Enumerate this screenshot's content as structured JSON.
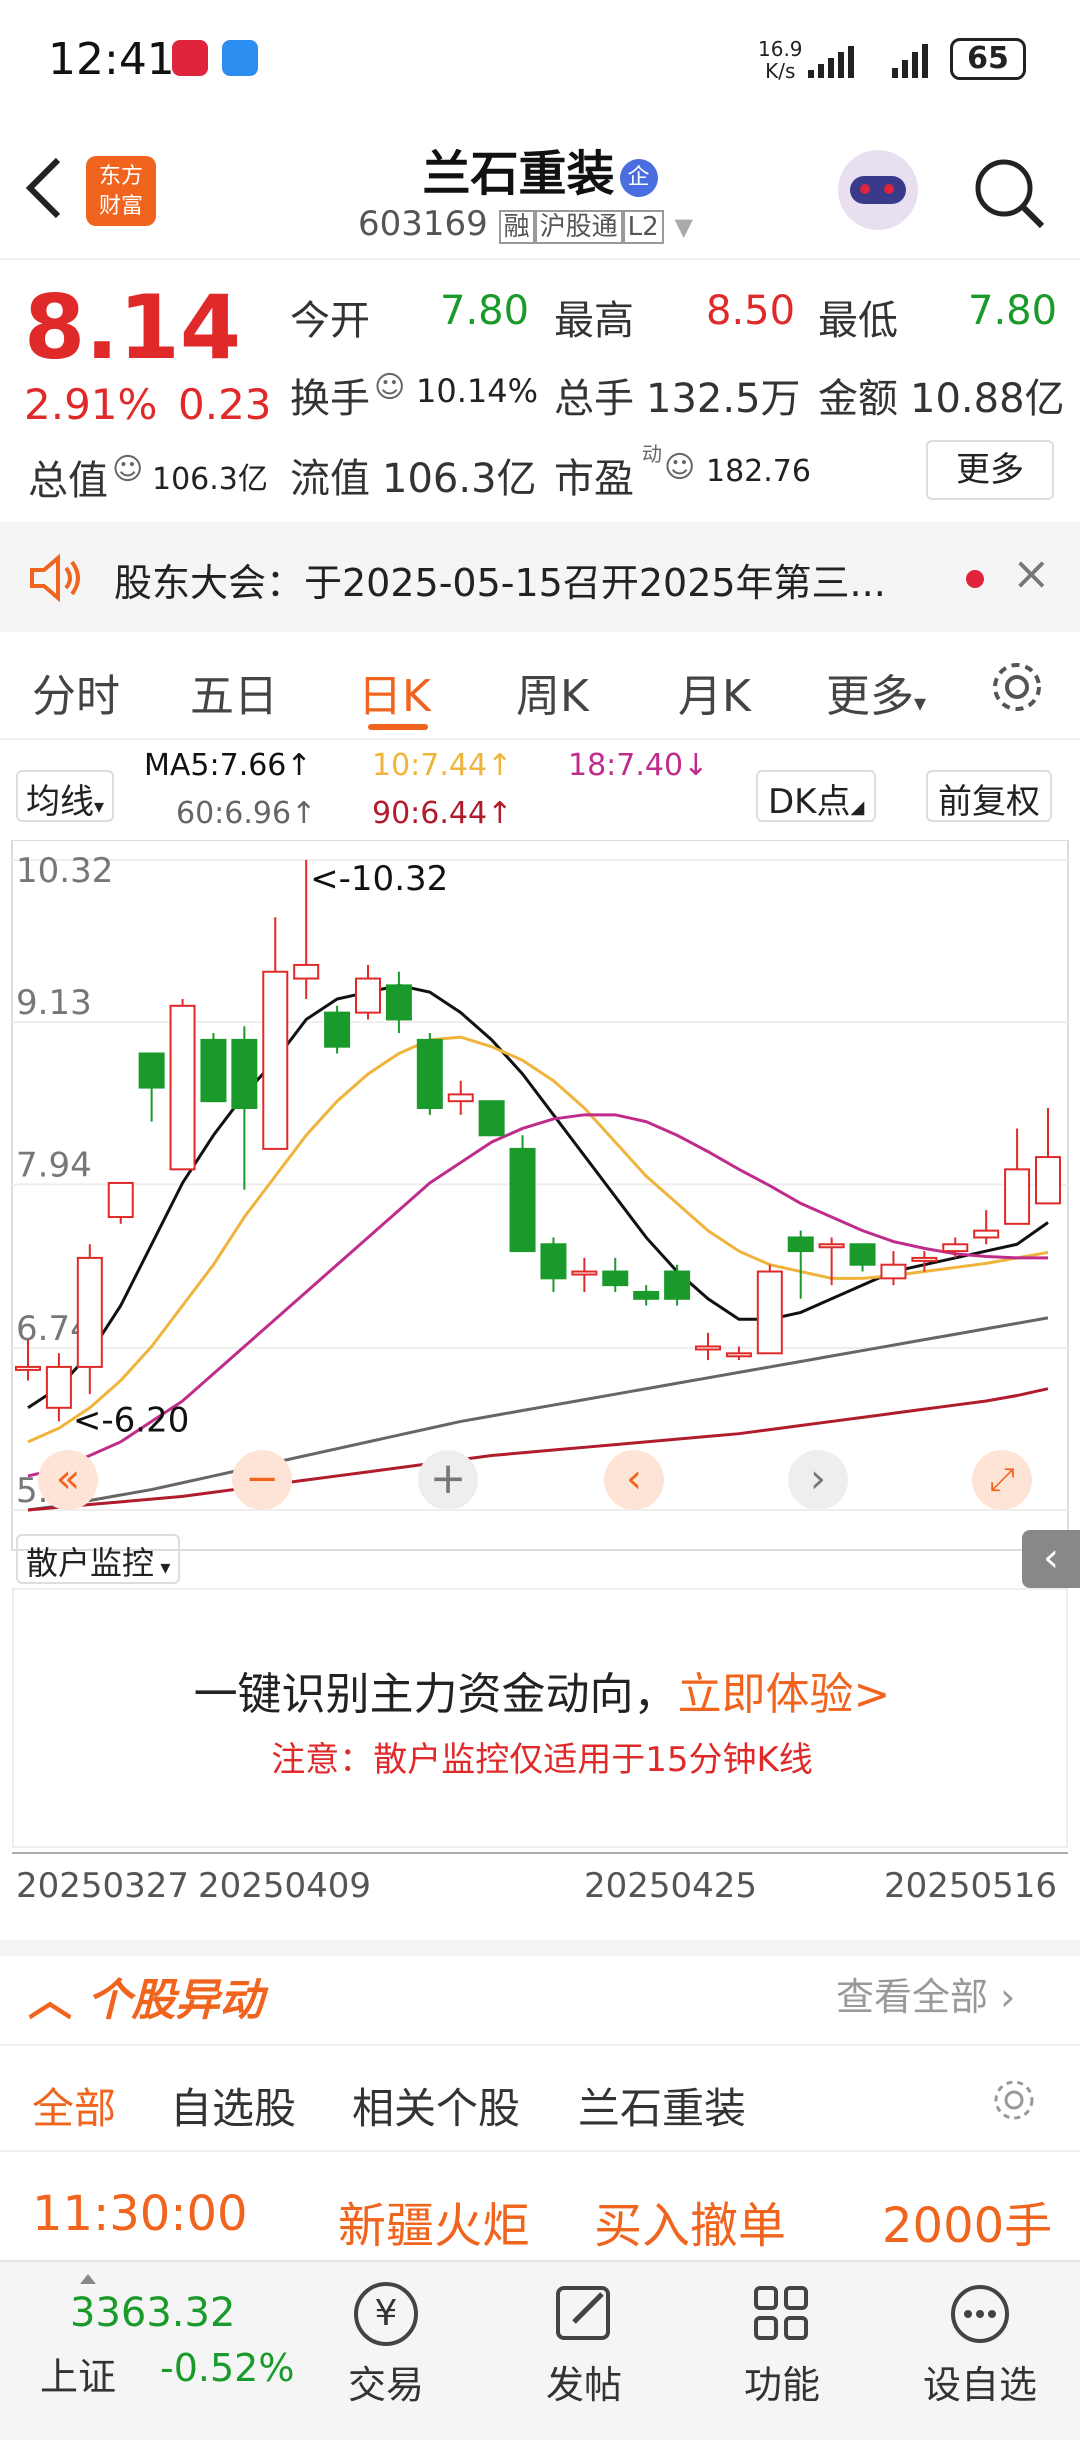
{
  "status": {
    "time": "12:41",
    "speed_top": "16.9",
    "speed_unit": "K/s",
    "battery": "65"
  },
  "header": {
    "stock_name": "兰石重装",
    "code": "603169",
    "badges": [
      "融",
      "沪股通",
      "L2"
    ],
    "logo_line1": "东方",
    "logo_line2": "财富",
    "verified": "企"
  },
  "quote": {
    "price": "8.14",
    "change_pct": "2.91%",
    "change_amt": "0.23",
    "open_label": "今开",
    "open": "7.80",
    "high_label": "最高",
    "high": "8.50",
    "low_label": "最低",
    "low": "7.80",
    "turnover_label": "换手",
    "turnover": "10.14%",
    "volume_label": "总手",
    "volume": "132.5万",
    "amount_label": "金额",
    "amount": "10.88亿",
    "mcap_label": "总值",
    "mcap": "106.3亿",
    "float_label": "流值",
    "float_cap": "106.3亿",
    "pe_label": "市盈",
    "pe_sup": "动",
    "pe": "182.76",
    "more": "更多"
  },
  "notice": {
    "text": "股东大会：于2025-05-15召开2025年第三..."
  },
  "tabs": [
    "分时",
    "五日",
    "日K",
    "周K",
    "月K",
    "更多"
  ],
  "ma": {
    "selector": "均线",
    "ma5": "MA5:7.66↑",
    "ma10": "10:7.44↑",
    "ma18": "18:7.40↓",
    "ma60": "60:6.96↑",
    "ma90": "90:6.44↑",
    "dk": "DK点",
    "fq": "前复权"
  },
  "chart_data": {
    "type": "candlestick",
    "y_ticks": [
      "10.32",
      "9.13",
      "7.94",
      "6.74",
      "5.55"
    ],
    "ylim": [
      5.55,
      10.32
    ],
    "max_label": "<-10.32",
    "min_label": "<-6.20",
    "x_ticks": [
      "20250327",
      "20250409",
      "20250425",
      "20250516"
    ],
    "candles": [
      {
        "o": 6.6,
        "c": 6.6,
        "h": 6.8,
        "l": 6.5
      },
      {
        "o": 6.3,
        "c": 6.6,
        "h": 6.7,
        "l": 6.2
      },
      {
        "o": 6.6,
        "c": 7.4,
        "h": 7.5,
        "l": 6.4
      },
      {
        "o": 7.7,
        "c": 7.95,
        "h": 7.95,
        "l": 7.65
      },
      {
        "o": 8.9,
        "c": 8.65,
        "h": 8.9,
        "l": 8.4
      },
      {
        "o": 8.05,
        "c": 9.25,
        "h": 9.3,
        "l": 8.05
      },
      {
        "o": 9.0,
        "c": 8.55,
        "h": 9.05,
        "l": 8.55
      },
      {
        "o": 9.0,
        "c": 8.5,
        "h": 9.1,
        "l": 7.9
      },
      {
        "o": 8.2,
        "c": 9.5,
        "h": 9.9,
        "l": 8.2
      },
      {
        "o": 9.45,
        "c": 9.55,
        "h": 10.32,
        "l": 9.3
      },
      {
        "o": 9.2,
        "c": 8.95,
        "h": 9.25,
        "l": 8.9
      },
      {
        "o": 9.2,
        "c": 9.45,
        "h": 9.55,
        "l": 9.15
      },
      {
        "o": 9.4,
        "c": 9.15,
        "h": 9.5,
        "l": 9.05
      },
      {
        "o": 9.0,
        "c": 8.5,
        "h": 9.05,
        "l": 8.45
      },
      {
        "o": 8.55,
        "c": 8.6,
        "h": 8.7,
        "l": 8.45
      },
      {
        "o": 8.55,
        "c": 8.3,
        "h": 8.55,
        "l": 8.3
      },
      {
        "o": 8.2,
        "c": 7.45,
        "h": 8.3,
        "l": 7.45
      },
      {
        "o": 7.5,
        "c": 7.25,
        "h": 7.55,
        "l": 7.15
      },
      {
        "o": 7.3,
        "c": 7.3,
        "h": 7.4,
        "l": 7.15
      },
      {
        "o": 7.3,
        "c": 7.2,
        "h": 7.4,
        "l": 7.15
      },
      {
        "o": 7.15,
        "c": 7.1,
        "h": 7.2,
        "l": 7.05
      },
      {
        "o": 7.3,
        "c": 7.1,
        "h": 7.35,
        "l": 7.05
      },
      {
        "o": 6.75,
        "c": 6.75,
        "h": 6.85,
        "l": 6.65
      },
      {
        "o": 6.7,
        "c": 6.7,
        "h": 6.75,
        "l": 6.65
      },
      {
        "o": 6.7,
        "c": 7.3,
        "h": 7.35,
        "l": 6.7
      },
      {
        "o": 7.55,
        "c": 7.45,
        "h": 7.6,
        "l": 7.1
      },
      {
        "o": 7.5,
        "c": 7.5,
        "h": 7.55,
        "l": 7.2
      },
      {
        "o": 7.5,
        "c": 7.35,
        "h": 7.5,
        "l": 7.3
      },
      {
        "o": 7.25,
        "c": 7.35,
        "h": 7.45,
        "l": 7.2
      },
      {
        "o": 7.4,
        "c": 7.4,
        "h": 7.45,
        "l": 7.3
      },
      {
        "o": 7.45,
        "c": 7.5,
        "h": 7.55,
        "l": 7.4
      },
      {
        "o": 7.55,
        "c": 7.6,
        "h": 7.75,
        "l": 7.5
      },
      {
        "o": 7.65,
        "c": 8.05,
        "h": 8.35,
        "l": 7.65
      },
      {
        "o": 7.8,
        "c": 8.14,
        "h": 8.5,
        "l": 7.8
      }
    ],
    "ma_series": [
      {
        "name": "MA5",
        "color": "#111111",
        "values": [
          6.3,
          6.45,
          6.7,
          7.05,
          7.5,
          7.95,
          8.3,
          8.6,
          8.85,
          9.15,
          9.3,
          9.35,
          9.4,
          9.35,
          9.2,
          9.0,
          8.75,
          8.45,
          8.15,
          7.85,
          7.55,
          7.3,
          7.1,
          6.95,
          6.95,
          7.0,
          7.1,
          7.2,
          7.3,
          7.35,
          7.4,
          7.45,
          7.5,
          7.66
        ]
      },
      {
        "name": "10",
        "color": "#f0b43c",
        "values": [
          6.05,
          6.15,
          6.3,
          6.5,
          6.75,
          7.05,
          7.35,
          7.7,
          8.0,
          8.3,
          8.55,
          8.75,
          8.9,
          9.0,
          9.02,
          8.95,
          8.85,
          8.7,
          8.5,
          8.25,
          8.0,
          7.8,
          7.6,
          7.45,
          7.35,
          7.3,
          7.25,
          7.25,
          7.27,
          7.3,
          7.33,
          7.36,
          7.4,
          7.44
        ]
      },
      {
        "name": "18",
        "color": "#c02c8c",
        "values": [
          5.8,
          5.85,
          5.95,
          6.05,
          6.2,
          6.35,
          6.55,
          6.75,
          6.95,
          7.15,
          7.35,
          7.55,
          7.75,
          7.95,
          8.1,
          8.25,
          8.35,
          8.42,
          8.45,
          8.45,
          8.4,
          8.3,
          8.18,
          8.05,
          7.93,
          7.8,
          7.7,
          7.6,
          7.52,
          7.47,
          7.43,
          7.41,
          7.4,
          7.4
        ]
      },
      {
        "name": "60",
        "color": "#666666",
        "values": [
          5.55,
          5.58,
          5.62,
          5.66,
          5.7,
          5.75,
          5.8,
          5.85,
          5.9,
          5.95,
          6.0,
          6.05,
          6.1,
          6.15,
          6.2,
          6.24,
          6.28,
          6.32,
          6.36,
          6.4,
          6.44,
          6.48,
          6.52,
          6.56,
          6.6,
          6.64,
          6.68,
          6.72,
          6.76,
          6.8,
          6.84,
          6.88,
          6.92,
          6.96
        ]
      },
      {
        "name": "90",
        "color": "#b01c2c",
        "values": [
          5.55,
          5.57,
          5.59,
          5.61,
          5.63,
          5.65,
          5.68,
          5.71,
          5.74,
          5.77,
          5.8,
          5.83,
          5.86,
          5.89,
          5.92,
          5.95,
          5.97,
          5.99,
          6.01,
          6.03,
          6.05,
          6.07,
          6.09,
          6.11,
          6.14,
          6.17,
          6.2,
          6.23,
          6.26,
          6.29,
          6.32,
          6.35,
          6.39,
          6.44
        ]
      }
    ]
  },
  "monitor": {
    "selector": "散户监控",
    "main_text": "一键识别主力资金动向，",
    "cta": "立即体验>",
    "note": "注意：散户监控仅适用于15分钟K线"
  },
  "movement": {
    "title": "个股异动",
    "view_all": "查看全部",
    "tabs": [
      "全部",
      "自选股",
      "相关个股",
      "兰石重装"
    ],
    "row": {
      "time": "11:30:00",
      "name": "新疆火炬",
      "action": "买入撤单",
      "qty": "2000手"
    }
  },
  "nav": {
    "index_value": "3363.32",
    "index_name": "上证",
    "index_change": "-0.52%",
    "items": [
      "交易",
      "发帖",
      "功能",
      "设自选"
    ],
    "trade_glyph": "¥"
  },
  "colors": {
    "up": "#e02a2a",
    "down": "#1a9a2a",
    "accent": "#f0641e"
  }
}
